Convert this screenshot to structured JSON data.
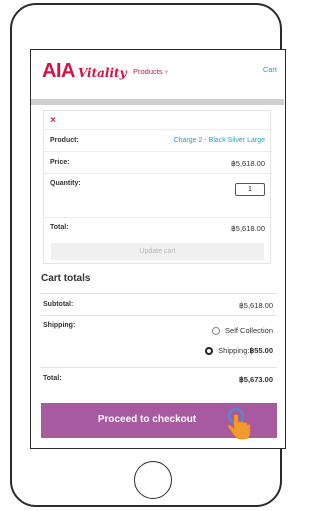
{
  "header": {
    "logo_aia": "AIA",
    "logo_vitality": "Vitality",
    "nav_products": "Products",
    "nav_products_chevron": "▾",
    "nav_cart": "Cart"
  },
  "cart_item": {
    "remove_symbol": "×",
    "product_label": "Product:",
    "product_value": "Charge 2 - Black Silver Large",
    "price_label": "Price:",
    "price_value": "฿5,618.00",
    "quantity_label": "Quantity:",
    "quantity_value": "1",
    "total_label": "Total:",
    "total_value": "฿5,618.00",
    "update_button": "Update cart"
  },
  "cart_totals": {
    "title": "Cart totals",
    "subtotal_label": "Subtotal:",
    "subtotal_value": "฿5,618.00",
    "shipping_label": "Shipping:",
    "shipping_option_1": "Self Collection",
    "shipping_option_2_label": "Shipping: ",
    "shipping_option_2_price": "฿55.00",
    "selected_shipping": "Shipping",
    "total_label": "Total:",
    "total_value": "฿5,673.00"
  },
  "checkout": {
    "button_label": "Proceed to checkout"
  },
  "colors": {
    "brand": "#d31145",
    "link": "#29a3c4",
    "checkout": "#a85aa0",
    "pointer": "#f39a2e"
  },
  "icons": {
    "remove": "close-icon",
    "pointer": "hand-pointer-icon"
  }
}
